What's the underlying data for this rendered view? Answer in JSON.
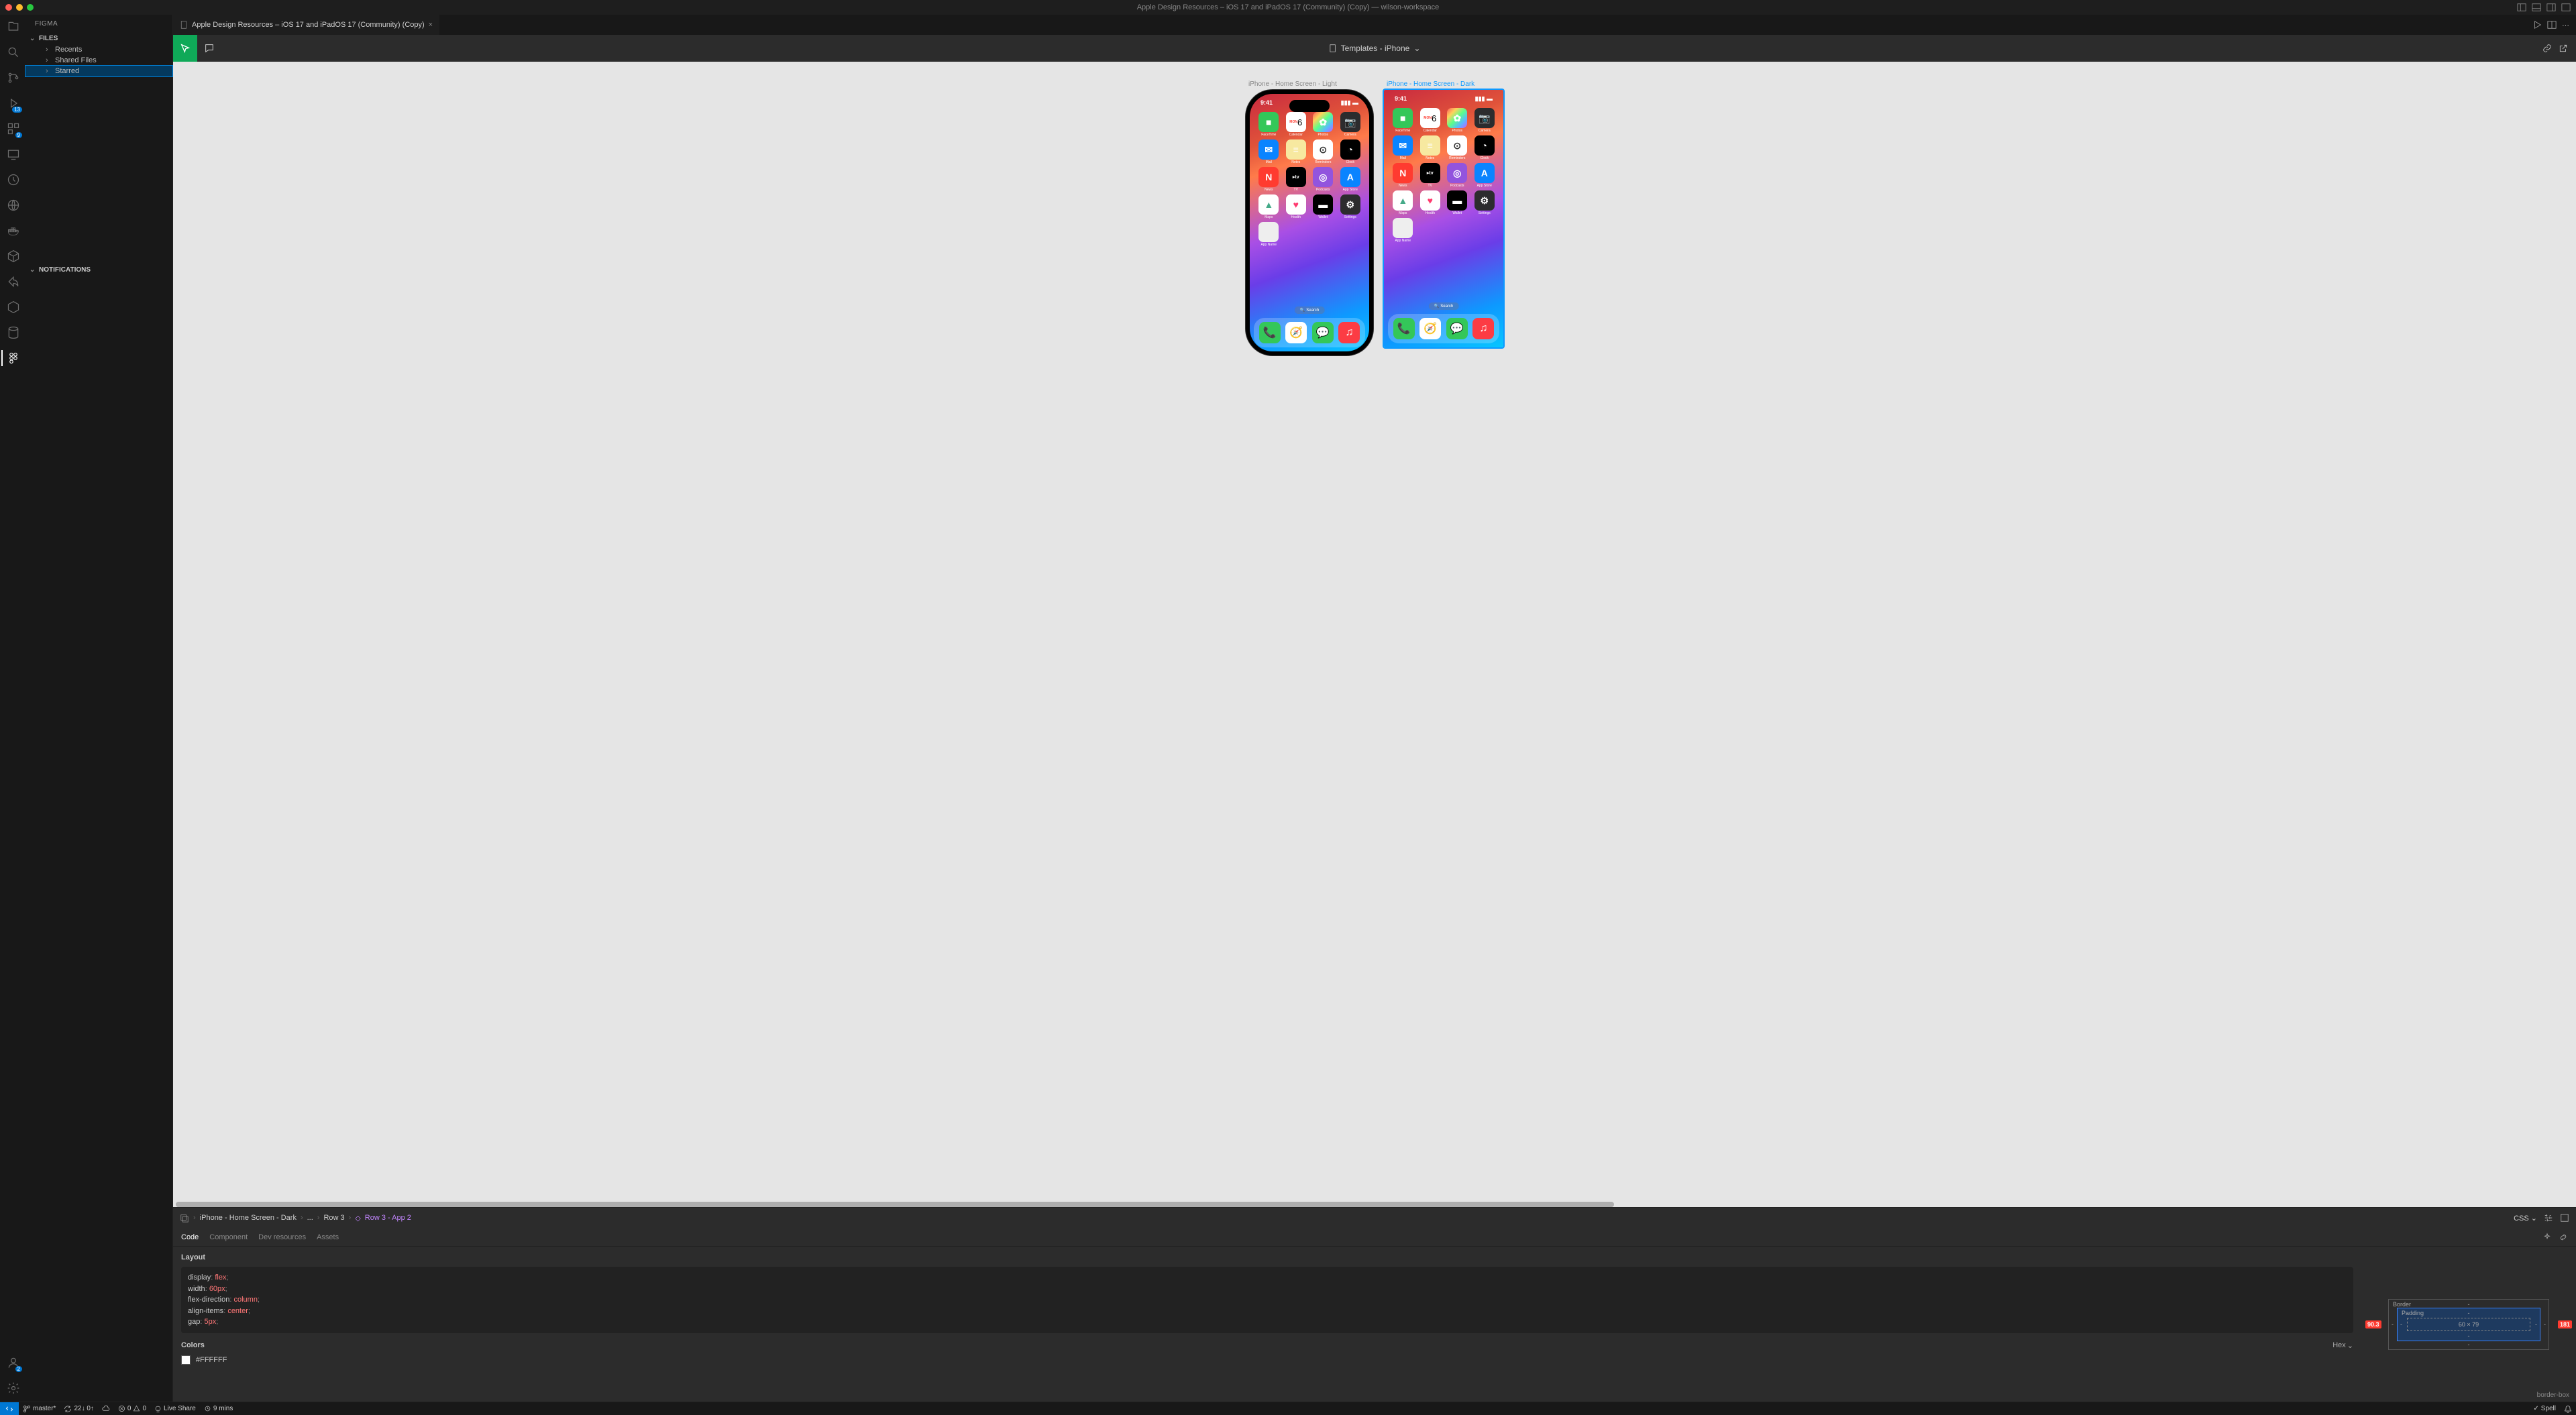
{
  "window": {
    "title": "Apple Design Resources – iOS 17 and iPadOS 17 (Community) (Copy) — wilson-workspace"
  },
  "activitybar": {
    "badge1": "13",
    "badge2": "9",
    "badge3": "2"
  },
  "sidebar": {
    "title": "FIGMA",
    "section1": "FILES",
    "items": {
      "recents": "Recents",
      "shared": "Shared Files",
      "starred": "Starred"
    },
    "section2": "NOTIFICATIONS"
  },
  "tab": {
    "label": "Apple Design Resources – iOS 17 and iPadOS 17 (Community) (Copy)"
  },
  "toolbar": {
    "page": "Templates - iPhone"
  },
  "canvas": {
    "frame1_label": "iPhone - Home Screen - Light",
    "frame2_label": "iPhone - Home Screen - Dark",
    "time": "9:41",
    "search": "Search",
    "apps": {
      "facetime": "FaceTime",
      "calendar": "Calendar",
      "cal_day": "6",
      "cal_dow": "MON",
      "photos": "Photos",
      "camera": "Camera",
      "mail": "Mail",
      "notes": "Notes",
      "reminders": "Reminders",
      "clock": "Clock",
      "news": "News",
      "tv": "TV",
      "podcasts": "Podcasts",
      "appstore": "App Store",
      "maps": "Maps",
      "health": "Health",
      "wallet": "Wallet",
      "settings": "Settings",
      "appname": "App Name"
    }
  },
  "inspector": {
    "breadcrumb": {
      "b1": "iPhone - Home Screen - Dark",
      "b2": "...",
      "b3": "Row 3",
      "b4": "Row 3 - App 2"
    },
    "css_label": "CSS",
    "tabs": {
      "code": "Code",
      "component": "Component",
      "dev": "Dev resources",
      "assets": "Assets"
    },
    "layout": {
      "title": "Layout",
      "css": [
        {
          "prop": "display",
          "val": "flex",
          "punc": ";"
        },
        {
          "prop": "width",
          "val": "60px",
          "punc": ";"
        },
        {
          "prop": "flex-direction",
          "val": "column",
          "punc": ";"
        },
        {
          "prop": "align-items",
          "val": "center",
          "punc": ";"
        },
        {
          "prop": "gap",
          "val": "5px",
          "punc": ";"
        }
      ]
    },
    "colors": {
      "title": "Colors",
      "hex_label": "Hex",
      "value": "#FFFFFF"
    },
    "boxmodel": {
      "border_label": "Border",
      "padding_label": "Padding",
      "content": "60 × 79",
      "left_badge": "90.3",
      "right_badge": "181",
      "corner_label": "border-box"
    }
  },
  "statusbar": {
    "branch": "master*",
    "sync": "22↓ 0↑",
    "errors": "0",
    "warnings": "0",
    "liveshare": "Live Share",
    "time": "9 mins",
    "spell": "Spell"
  }
}
